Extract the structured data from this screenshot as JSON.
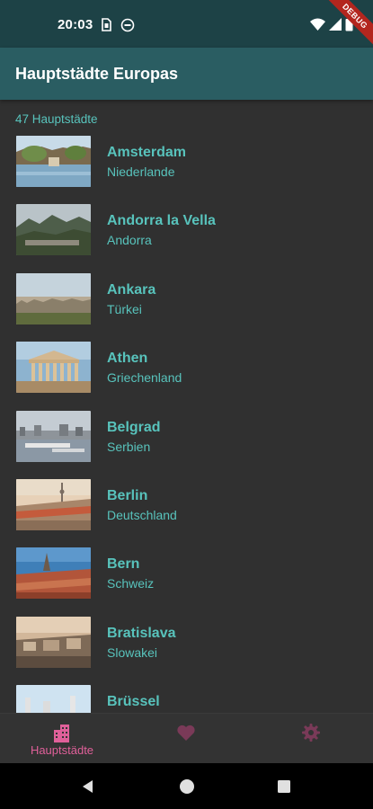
{
  "status_bar": {
    "time": "20:03",
    "debug_label": "DEBUG"
  },
  "app_bar": {
    "title": "Hauptstädte Europas"
  },
  "list": {
    "count_label": "47 Hauptstädte",
    "items": [
      {
        "city": "Amsterdam",
        "country": "Niederlande"
      },
      {
        "city": "Andorra la Vella",
        "country": "Andorra"
      },
      {
        "city": "Ankara",
        "country": "Türkei"
      },
      {
        "city": "Athen",
        "country": "Griechenland"
      },
      {
        "city": "Belgrad",
        "country": "Serbien"
      },
      {
        "city": "Berlin",
        "country": "Deutschland"
      },
      {
        "city": "Bern",
        "country": "Schweiz"
      },
      {
        "city": "Bratislava",
        "country": "Slowakei"
      },
      {
        "city": "Brüssel",
        "country": ""
      }
    ]
  },
  "bottom_nav": {
    "items": [
      {
        "label": "Hauptstädte",
        "icon": "city-icon",
        "active": true
      },
      {
        "label": "",
        "icon": "heart-icon",
        "active": false
      },
      {
        "label": "",
        "icon": "gear-icon",
        "active": false
      }
    ]
  },
  "colors": {
    "accent": "#58c3bc",
    "active_nav": "#e0609a",
    "inactive_nav": "#7a3a58",
    "app_bar": "#2a5d62",
    "status_bar": "#1d4246",
    "background": "#303030"
  }
}
